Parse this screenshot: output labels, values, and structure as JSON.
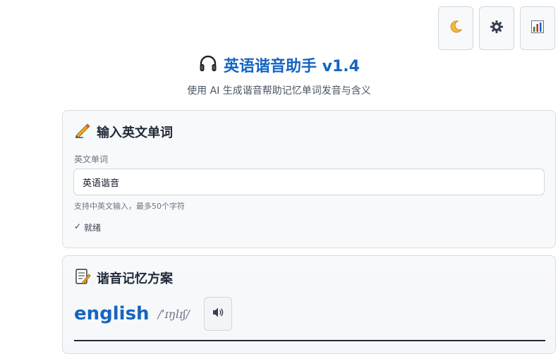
{
  "toolbar": {
    "buttons": [
      {
        "name": "theme-toggle",
        "icon": "moon-icon"
      },
      {
        "name": "settings",
        "icon": "gear-icon"
      },
      {
        "name": "stats",
        "icon": "bar-chart-icon"
      }
    ]
  },
  "header": {
    "icon": "headphones-icon",
    "title": "英语谐音助手 v1.4",
    "subtitle": "使用 AI 生成谐音帮助记忆单词发音与含义"
  },
  "input_card": {
    "icon": "pencil-icon",
    "title": "输入英文单词",
    "field_label": "英文单词",
    "value": "英语谐音",
    "hint": "支持中英文输入，最多50个字符",
    "status_icon": "checkmark-icon",
    "status": "就绪"
  },
  "result_card": {
    "icon": "memo-icon",
    "title": "谐音记忆方案",
    "word": "english",
    "phonetic": "/ˈɪŋlɪʃ/",
    "speak_icon": "speaker-icon"
  },
  "colors": {
    "accent": "#1565c0",
    "card_bg": "#f8f9fa",
    "border": "#d1d5db"
  }
}
